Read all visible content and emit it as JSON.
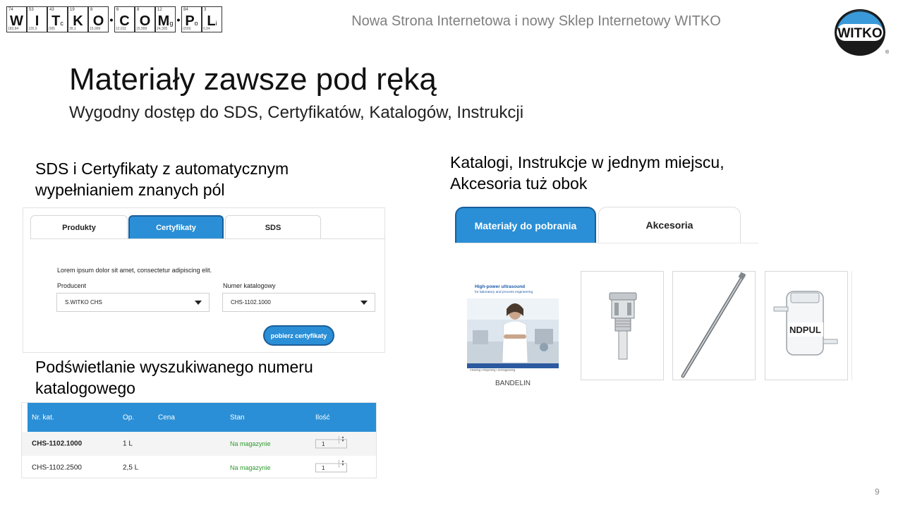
{
  "logo": {
    "tiles": [
      {
        "num": "74",
        "sym": "W",
        "sub": "",
        "mass": "183,84"
      },
      {
        "num": "53",
        "sym": "I",
        "sub": "",
        "mass": "126,9"
      },
      {
        "num": "43",
        "sym": "T",
        "sub": "c",
        "mass": "(98)"
      },
      {
        "num": "19",
        "sym": "K",
        "sub": "",
        "mass": "39,1"
      },
      {
        "num": "8",
        "sym": "O",
        "sub": "",
        "mass": "15,999"
      },
      {
        "num": "6",
        "sym": "C",
        "sub": "",
        "mass": "12,011"
      },
      {
        "num": "8",
        "sym": "O",
        "sub": "",
        "mass": "15,999"
      },
      {
        "num": "12",
        "sym": "M",
        "sub": "g",
        "mass": "24,305"
      },
      {
        "num": "84",
        "sym": "P",
        "sub": "o",
        "mass": "(209)"
      },
      {
        "num": "3",
        "sym": "L",
        "sub": "i",
        "mass": "6,94"
      }
    ]
  },
  "header": {
    "title": "Nowa Strona Internetowa i nowy Sklep Internetowy WITKO",
    "brand": "WITKO",
    "registered": "®"
  },
  "slide": {
    "title": "Materiały zawsze pod ręką",
    "subtitle": "Wygodny dostęp do SDS, Certyfikatów, Katalogów, Instrukcji",
    "page_number": "9"
  },
  "captions": {
    "cert_line1": "SDS i Certyfikaty z automatycznym",
    "cert_line2": "wypełnianiem znanych pól",
    "highlight_line1": "Podświetlanie wyszukiwanego numeru",
    "highlight_line2": "katalogowego",
    "downloads_line1": "Katalogi, Instrukcje w jednym miejscu,",
    "downloads_line2": "Akcesoria tuż obok"
  },
  "cert_panel": {
    "tabs": [
      "Produkty",
      "Certyfikaty",
      "SDS"
    ],
    "active_tab": "Certyfikaty",
    "lorem": "Lorem ipsum dolor sit amet, consectetur adipiscing elit.",
    "producer_label": "Producent",
    "producer_value": "S.WITKO CHS",
    "catalog_label": "Numer katalogowy",
    "catalog_value": "CHS-1102.1000",
    "button": "pobierz certyfikaty"
  },
  "product_table": {
    "headers": [
      "Nr. kat.",
      "Op.",
      "Cena",
      "Stan",
      "Ilość"
    ],
    "rows": [
      {
        "code": "CHS-1102.1000",
        "pack": "1 L",
        "price": "",
        "stock": "Na magazynie",
        "qty": "1",
        "highlighted": true
      },
      {
        "code": "CHS-1102.2500",
        "pack": "2,5 L",
        "price": "",
        "stock": "Na magazynie",
        "qty": "1",
        "highlighted": false
      }
    ]
  },
  "downloads": {
    "tabs": [
      "Materiały do pobrania",
      "Akcesoria"
    ],
    "active_tab": "Materiały do pobrania",
    "catalog_heading_1": "High-power ultrasound",
    "catalog_heading_2": "for laboratory and process engineering",
    "catalog_footer": "Cleaning • Dispersing • Homogenising",
    "catalog_caption": "BANDELIN",
    "accessory_label": "NDPUL"
  },
  "colors": {
    "accent": "#2a8fd6",
    "accent_border": "#1a5e9a",
    "stock_green": "#2f9a2f",
    "header_gray": "#7f7f7f"
  }
}
